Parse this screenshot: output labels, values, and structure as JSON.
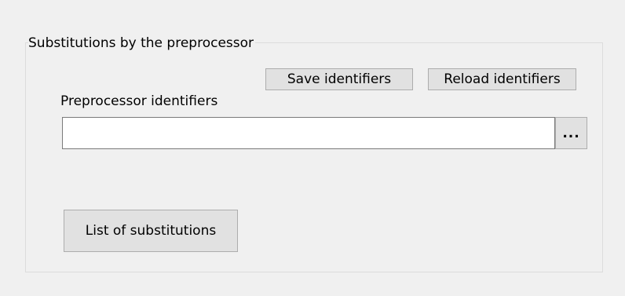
{
  "group": {
    "title": "Substitutions by the preprocessor"
  },
  "buttons": {
    "save_label": "Save identifiers",
    "reload_label": "Reload identifiers",
    "browse_label": "...",
    "list_label": "List of substitutions"
  },
  "identifiers_field": {
    "label": "Preprocessor identifiers",
    "value": ""
  }
}
